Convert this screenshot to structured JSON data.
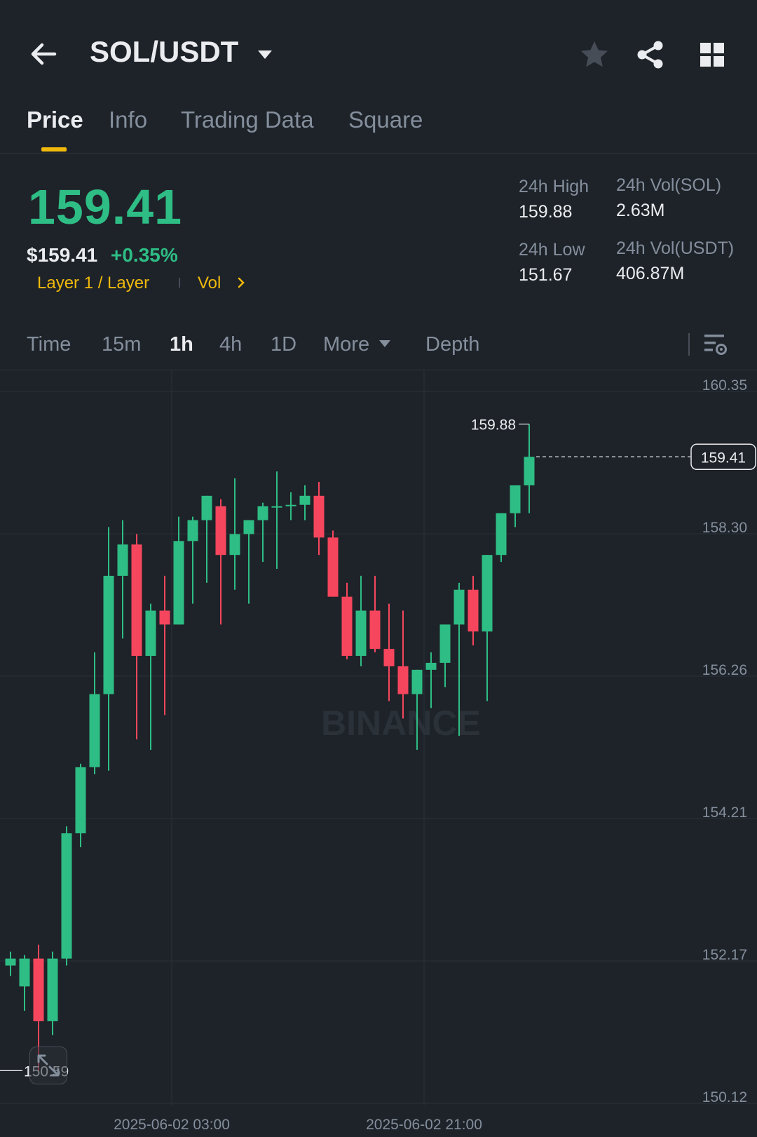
{
  "header": {
    "pair": "SOL/USDT",
    "icons": [
      "back-arrow-icon",
      "caret-down-icon",
      "star-icon",
      "share-icon",
      "grid-icon"
    ]
  },
  "tabs": [
    {
      "label": "Price",
      "active": true
    },
    {
      "label": "Info",
      "active": false
    },
    {
      "label": "Trading Data",
      "active": false
    },
    {
      "label": "Square",
      "active": false
    }
  ],
  "price": {
    "last": "159.41",
    "usd": "$159.41",
    "change": "+0.35%",
    "tags": [
      "Layer 1 / Layer",
      "Vol"
    ]
  },
  "stats": {
    "high_label": "24h High",
    "high_value": "159.88",
    "low_label": "24h Low",
    "low_value": "151.67",
    "vol_sol_label": "24h Vol(SOL)",
    "vol_sol_value": "2.63M",
    "vol_usdt_label": "24h Vol(USDT)",
    "vol_usdt_value": "406.87M"
  },
  "timeframes": [
    {
      "label": "Time",
      "active": false
    },
    {
      "label": "15m",
      "active": false
    },
    {
      "label": "1h",
      "active": true
    },
    {
      "label": "4h",
      "active": false
    },
    {
      "label": "1D",
      "active": false
    },
    {
      "label": "More",
      "active": false
    },
    {
      "label": "Depth",
      "active": false
    }
  ],
  "colors": {
    "background": "#1e2329",
    "up": "#2ebd85",
    "down": "#f6465d",
    "accent": "#f0b90b",
    "muted": "#848e9c",
    "grid": "#2b3139"
  },
  "chart_data": {
    "type": "candlestick",
    "watermark": "BINANCE",
    "ylim": [
      150.12,
      160.35
    ],
    "y_ticks": [
      "160.35",
      "158.30",
      "156.26",
      "154.21",
      "152.17",
      "150.12"
    ],
    "x_ticks": [
      "2025-06-02 03:00",
      "2025-06-02 21:00"
    ],
    "x_tick_index": [
      11.5,
      29.5
    ],
    "last_price": "159.41",
    "high_marker": "159.88",
    "low_marker": "150.59",
    "candles": [
      {
        "o": 152.1,
        "h": 152.3,
        "l": 151.95,
        "c": 152.2
      },
      {
        "o": 151.8,
        "h": 152.25,
        "l": 151.45,
        "c": 152.2
      },
      {
        "o": 152.2,
        "h": 152.4,
        "l": 150.59,
        "c": 151.3
      },
      {
        "o": 151.3,
        "h": 152.3,
        "l": 151.1,
        "c": 152.2
      },
      {
        "o": 152.2,
        "h": 154.1,
        "l": 152.1,
        "c": 154.0
      },
      {
        "o": 154.0,
        "h": 155.0,
        "l": 153.8,
        "c": 154.95
      },
      {
        "o": 154.95,
        "h": 156.6,
        "l": 154.85,
        "c": 156.0
      },
      {
        "o": 156.0,
        "h": 158.4,
        "l": 154.9,
        "c": 157.7
      },
      {
        "o": 157.7,
        "h": 158.5,
        "l": 156.8,
        "c": 158.15
      },
      {
        "o": 158.15,
        "h": 158.3,
        "l": 155.35,
        "c": 156.55
      },
      {
        "o": 156.55,
        "h": 157.3,
        "l": 155.2,
        "c": 157.2
      },
      {
        "o": 157.2,
        "h": 157.7,
        "l": 155.7,
        "c": 157.0
      },
      {
        "o": 157.0,
        "h": 158.55,
        "l": 157.6,
        "c": 158.2
      },
      {
        "o": 158.2,
        "h": 158.55,
        "l": 157.3,
        "c": 158.5
      },
      {
        "o": 158.5,
        "h": 158.8,
        "l": 157.6,
        "c": 158.85
      },
      {
        "o": 158.7,
        "h": 158.8,
        "l": 157.0,
        "c": 158.0
      },
      {
        "o": 158.0,
        "h": 159.1,
        "l": 157.5,
        "c": 158.3
      },
      {
        "o": 158.3,
        "h": 158.45,
        "l": 157.3,
        "c": 158.5
      },
      {
        "o": 158.5,
        "h": 158.75,
        "l": 157.9,
        "c": 158.7
      },
      {
        "o": 158.7,
        "h": 159.2,
        "l": 157.8,
        "c": 158.7
      },
      {
        "o": 158.7,
        "h": 158.9,
        "l": 158.5,
        "c": 158.72
      },
      {
        "o": 158.72,
        "h": 159.0,
        "l": 158.5,
        "c": 158.85
      },
      {
        "o": 158.85,
        "h": 159.05,
        "l": 158.0,
        "c": 158.25
      },
      {
        "o": 158.25,
        "h": 158.35,
        "l": 157.4,
        "c": 157.4
      },
      {
        "o": 157.4,
        "h": 157.6,
        "l": 156.5,
        "c": 156.55
      },
      {
        "o": 156.55,
        "h": 157.7,
        "l": 156.4,
        "c": 157.2
      },
      {
        "o": 157.2,
        "h": 157.7,
        "l": 156.6,
        "c": 156.65
      },
      {
        "o": 156.65,
        "h": 157.3,
        "l": 155.9,
        "c": 156.4
      },
      {
        "o": 156.4,
        "h": 157.2,
        "l": 155.65,
        "c": 156.0
      },
      {
        "o": 156.0,
        "h": 156.0,
        "l": 155.2,
        "c": 156.35
      },
      {
        "o": 156.35,
        "h": 156.6,
        "l": 155.8,
        "c": 156.45
      },
      {
        "o": 156.45,
        "h": 156.85,
        "l": 156.1,
        "c": 157.0
      },
      {
        "o": 157.0,
        "h": 157.6,
        "l": 155.4,
        "c": 157.5
      },
      {
        "o": 157.5,
        "h": 157.7,
        "l": 156.7,
        "c": 156.9
      },
      {
        "o": 156.9,
        "h": 157.1,
        "l": 155.9,
        "c": 158.0
      },
      {
        "o": 158.0,
        "h": 158.2,
        "l": 157.9,
        "c": 158.6
      },
      {
        "o": 158.6,
        "h": 158.75,
        "l": 158.4,
        "c": 159.0
      },
      {
        "o": 159.0,
        "h": 159.88,
        "l": 158.6,
        "c": 159.41
      }
    ]
  }
}
